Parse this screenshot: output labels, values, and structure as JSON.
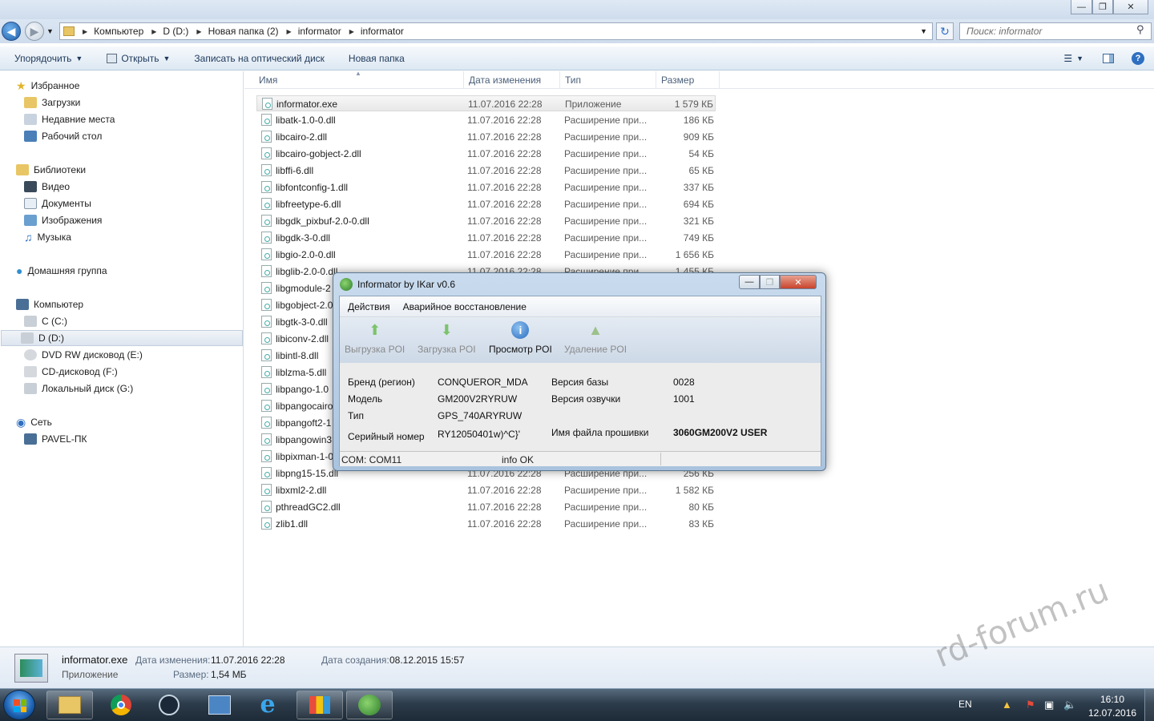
{
  "window": {
    "min": "—",
    "max": "❐",
    "close": "✕"
  },
  "address": {
    "crumbs": [
      "Компьютер",
      "D (D:)",
      "Новая папка (2)",
      "informator",
      "informator"
    ],
    "search_placeholder": "Поиск: informator"
  },
  "toolbar": {
    "organize": "Упорядочить",
    "open": "Открыть",
    "burn": "Записать на оптический диск",
    "new_folder": "Новая папка"
  },
  "nav": {
    "favorites": "Избранное",
    "fav_items": [
      "Загрузки",
      "Недавние места",
      "Рабочий стол"
    ],
    "libraries": "Библиотеки",
    "lib_items": [
      "Видео",
      "Документы",
      "Изображения",
      "Музыка"
    ],
    "homegroup": "Домашняя группа",
    "computer": "Компьютер",
    "drives": [
      "C (C:)",
      "D (D:)",
      "DVD RW дисковод (E:)",
      "CD-дисковод (F:)",
      "Локальный диск (G:)"
    ],
    "network": "Сеть",
    "pc": "PAVEL-ПК"
  },
  "columns": {
    "name": "Имя",
    "date": "Дата изменения",
    "type": "Тип",
    "size": "Размер"
  },
  "files": [
    {
      "name": "informator.exe",
      "date": "11.07.2016 22:28",
      "type": "Приложение",
      "size": "1 579 КБ"
    },
    {
      "name": "libatk-1.0-0.dll",
      "date": "11.07.2016 22:28",
      "type": "Расширение при...",
      "size": "186 КБ"
    },
    {
      "name": "libcairo-2.dll",
      "date": "11.07.2016 22:28",
      "type": "Расширение при...",
      "size": "909 КБ"
    },
    {
      "name": "libcairo-gobject-2.dll",
      "date": "11.07.2016 22:28",
      "type": "Расширение при...",
      "size": "54 КБ"
    },
    {
      "name": "libffi-6.dll",
      "date": "11.07.2016 22:28",
      "type": "Расширение при...",
      "size": "65 КБ"
    },
    {
      "name": "libfontconfig-1.dll",
      "date": "11.07.2016 22:28",
      "type": "Расширение при...",
      "size": "337 КБ"
    },
    {
      "name": "libfreetype-6.dll",
      "date": "11.07.2016 22:28",
      "type": "Расширение при...",
      "size": "694 КБ"
    },
    {
      "name": "libgdk_pixbuf-2.0-0.dll",
      "date": "11.07.2016 22:28",
      "type": "Расширение при...",
      "size": "321 КБ"
    },
    {
      "name": "libgdk-3-0.dll",
      "date": "11.07.2016 22:28",
      "type": "Расширение при...",
      "size": "749 КБ"
    },
    {
      "name": "libgio-2.0-0.dll",
      "date": "11.07.2016 22:28",
      "type": "Расширение при...",
      "size": "1 656 КБ"
    },
    {
      "name": "libglib-2.0-0.dll",
      "date": "11.07.2016 22:28",
      "type": "Расширение при...",
      "size": "1 455 КБ"
    },
    {
      "name": "libgmodule-2",
      "date": "",
      "type": "",
      "size": ""
    },
    {
      "name": "libgobject-2.0",
      "date": "",
      "type": "",
      "size": ""
    },
    {
      "name": "libgtk-3-0.dll",
      "date": "",
      "type": "",
      "size": ""
    },
    {
      "name": "libiconv-2.dll",
      "date": "",
      "type": "",
      "size": ""
    },
    {
      "name": "libintl-8.dll",
      "date": "",
      "type": "",
      "size": ""
    },
    {
      "name": "liblzma-5.dll",
      "date": "",
      "type": "",
      "size": ""
    },
    {
      "name": "libpango-1.0",
      "date": "",
      "type": "",
      "size": ""
    },
    {
      "name": "libpangocairo",
      "date": "",
      "type": "",
      "size": ""
    },
    {
      "name": "libpangoft2-1",
      "date": "",
      "type": "",
      "size": ""
    },
    {
      "name": "libpangowin3",
      "date": "",
      "type": "",
      "size": ""
    },
    {
      "name": "libpixman-1-0",
      "date": "",
      "type": "",
      "size": ""
    },
    {
      "name": "libpng15-15.dll",
      "date": "11.07.2016 22:28",
      "type": "Расширение при...",
      "size": "256 КБ"
    },
    {
      "name": "libxml2-2.dll",
      "date": "11.07.2016 22:28",
      "type": "Расширение при...",
      "size": "1 582 КБ"
    },
    {
      "name": "pthreadGC2.dll",
      "date": "11.07.2016 22:28",
      "type": "Расширение при...",
      "size": "80 КБ"
    },
    {
      "name": "zlib1.dll",
      "date": "11.07.2016 22:28",
      "type": "Расширение при...",
      "size": "83 КБ"
    }
  ],
  "details": {
    "name": "informator.exe",
    "type": "Приложение",
    "modified_label": "Дата изменения:",
    "modified": "11.07.2016 22:28",
    "created_label": "Дата создания:",
    "created": "08.12.2015 15:57",
    "size_label": "Размер:",
    "size": "1,54 МБ"
  },
  "dialog": {
    "title": "Informator by IKar v0.6",
    "menu": [
      "Действия",
      "Аварийное восстановление"
    ],
    "tools": [
      "Выгрузка POI",
      "Загрузка POI",
      "Просмотр POI",
      "Удаление POI"
    ],
    "brand_label": "Бренд  (регион)",
    "brand": "CONQUEROR_MDA",
    "model_label": "Модель",
    "model": "GM200V2RYRUW",
    "type_label": "Тип",
    "type": "GPS_740ARYRUW",
    "serial_label": "Серийный номер",
    "serial": "RY12050401w)^C}'",
    "db_label": "Версия базы",
    "db": "0028",
    "voice_label": "Версия озвучки",
    "voice": "1001",
    "fw_label": "Имя файла прошивки",
    "fw": "3060GM200V2 USER",
    "status_com": "COM: COM11",
    "status_info": "info OK"
  },
  "tray": {
    "lang": "EN",
    "time": "16:10",
    "date": "12.07.2016"
  },
  "watermark": "rd-forum.ru",
  "colors": {
    "accent": "#1e395b",
    "selection": "#dde5ef",
    "taskbar": "#2d3c4b"
  }
}
